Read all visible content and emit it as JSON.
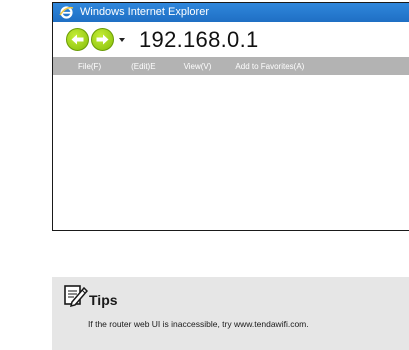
{
  "browser": {
    "title": "Windows Internet Explorer",
    "address": "192.168.0.1",
    "menu": [
      "File(F)",
      "(Edit)E",
      "View(V)",
      "Add to Favorites(A)"
    ]
  },
  "tips": {
    "title": "Tips",
    "text": "If the router web UI is inaccessible, try www.tendawifi.com."
  },
  "colors": {
    "title_bar": "#2478d2",
    "menu_bar": "#b3b3b3",
    "nav_button": "#9bd10f",
    "tips_background": "#e6e6e6"
  },
  "icons": {
    "browser": "ie-logo-icon",
    "back": "back-arrow-icon",
    "forward": "forward-arrow-icon",
    "tips": "notepad-pencil-icon"
  }
}
